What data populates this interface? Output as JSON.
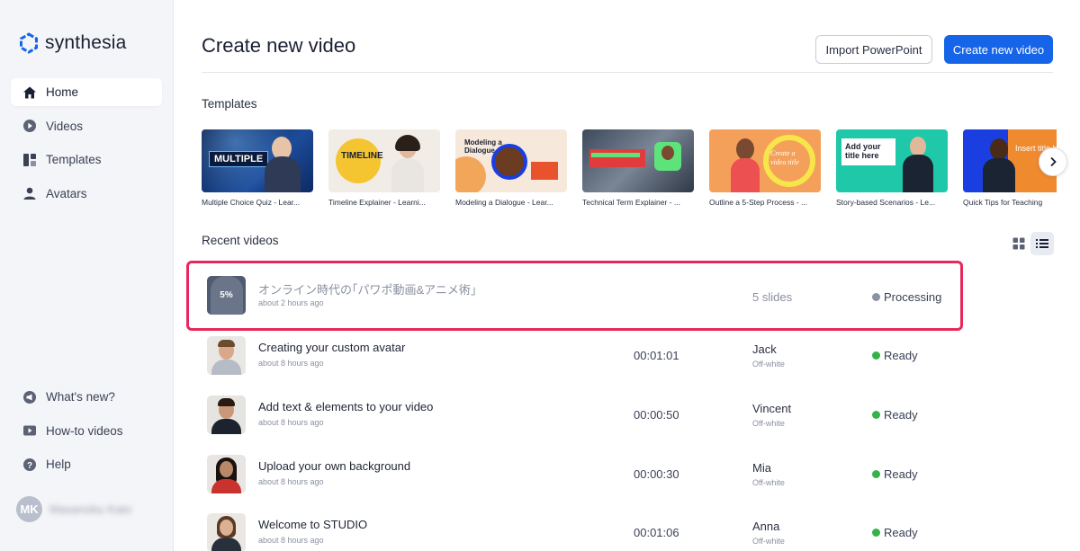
{
  "brand": {
    "name": "synthesia",
    "accent": "#1664e8",
    "highlight": "#e8285d"
  },
  "sidebar": {
    "items": [
      {
        "label": "Home",
        "icon": "home-icon",
        "active": true
      },
      {
        "label": "Videos",
        "icon": "play-circle-icon"
      },
      {
        "label": "Templates",
        "icon": "templates-icon"
      },
      {
        "label": "Avatars",
        "icon": "user-icon"
      }
    ],
    "bottom_items": [
      {
        "label": "What's new?",
        "icon": "megaphone-icon"
      },
      {
        "label": "How-to videos",
        "icon": "video-icon"
      },
      {
        "label": "Help",
        "icon": "help-icon"
      }
    ],
    "user": {
      "initials": "MK",
      "name": "Masanobu Kato"
    }
  },
  "header": {
    "title": "Create new video",
    "import_label": "Import PowerPoint",
    "create_label": "Create new video"
  },
  "templates": {
    "title": "Templates",
    "items": [
      {
        "caption": "Multiple Choice Quiz - Lear...",
        "thumb_text": "MULTIPLE"
      },
      {
        "caption": "Timeline Explainer - Learni...",
        "thumb_text": "TIMELINE"
      },
      {
        "caption": "Modeling a Dialogue - Lear...",
        "thumb_text": "Modeling a Dialogue"
      },
      {
        "caption": "Technical Term Explainer - ...",
        "thumb_text": ""
      },
      {
        "caption": "Outline a 5-Step Process - ...",
        "thumb_text": "Create a video title"
      },
      {
        "caption": "Story-based Scenarios - Le...",
        "thumb_text": "Add your title here"
      },
      {
        "caption": "Quick Tips for Teaching",
        "thumb_text": "Insert title h"
      }
    ]
  },
  "recent": {
    "title": "Recent videos",
    "rows": [
      {
        "title": "オンライン時代の｢パワポ動画&アニメ術｣",
        "time": "about 2 hours ago",
        "duration": "",
        "avatar": "5 slides",
        "background": "",
        "status": "Processing",
        "status_color": "#8a93a6",
        "progress": "5%"
      },
      {
        "title": "Creating your custom avatar",
        "time": "about 8 hours ago",
        "duration": "00:01:01",
        "avatar": "Jack",
        "background": "Off-white",
        "status": "Ready",
        "status_color": "#35b34a"
      },
      {
        "title": "Add text & elements to your video",
        "time": "about 8 hours ago",
        "duration": "00:00:50",
        "avatar": "Vincent",
        "background": "Off-white",
        "status": "Ready",
        "status_color": "#35b34a"
      },
      {
        "title": "Upload your own background",
        "time": "about 8 hours ago",
        "duration": "00:00:30",
        "avatar": "Mia",
        "background": "Off-white",
        "status": "Ready",
        "status_color": "#35b34a"
      },
      {
        "title": "Welcome to STUDIO",
        "time": "about 8 hours ago",
        "duration": "00:01:06",
        "avatar": "Anna",
        "background": "Off-white",
        "status": "Ready",
        "status_color": "#35b34a"
      }
    ]
  }
}
